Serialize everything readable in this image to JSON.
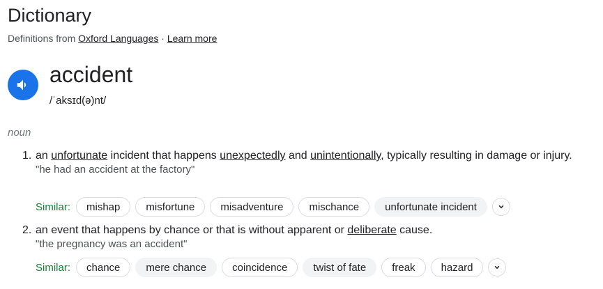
{
  "header": {
    "title": "Dictionary",
    "source_prefix": "Definitions from ",
    "source_link": "Oxford Languages",
    "separator": " · ",
    "learn_more": "Learn more"
  },
  "entry": {
    "word": "accident",
    "phonetic": "/ˈaksɪd(ə)nt/",
    "part_of_speech": "noun"
  },
  "senses": [
    {
      "number": "1.",
      "def_parts": [
        "an ",
        "unfortunate",
        " incident that happens ",
        "unexpectedly",
        " and ",
        "unintentionally",
        ", typically resulting in damage or injury."
      ],
      "example": "\"he had an accident at the factory\"",
      "similar_label": "Similar:",
      "similar": [
        "mishap",
        "misfortune",
        "misadventure",
        "mischance",
        "unfortunate incident"
      ]
    },
    {
      "number": "2.",
      "def_parts": [
        "an event that happens by chance or that is without apparent or ",
        "deliberate",
        " cause."
      ],
      "example": "\"the pregnancy was an accident\"",
      "similar_label": "Similar:",
      "similar": [
        "chance",
        "mere chance",
        "coincidence",
        "twist of fate",
        "freak",
        "hazard"
      ]
    }
  ],
  "icons": {
    "speaker": "speaker-icon",
    "expand": "chevron-down-icon"
  },
  "colors": {
    "speaker_bg": "#1a73e8",
    "similar_label": "#188038",
    "chip_highlight": "#f1f3f4"
  }
}
